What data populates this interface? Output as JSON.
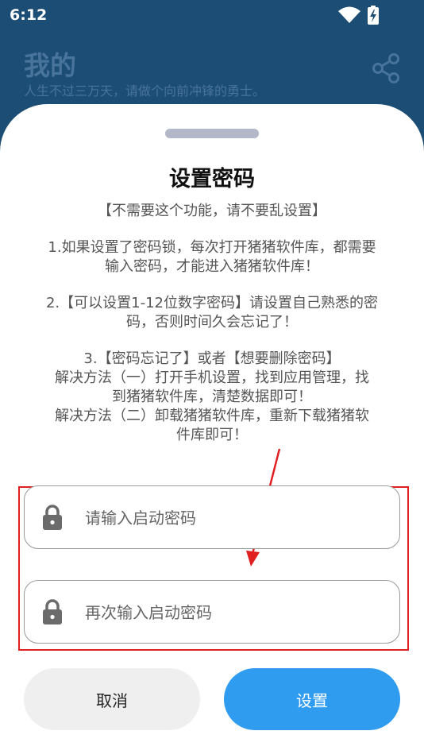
{
  "status_bar": {
    "time": "6:12"
  },
  "header": {
    "title": "我的",
    "subtitle": "人生不过三万天，请做个向前冲锋的勇士。"
  },
  "dialog": {
    "title": "设置密码",
    "notice_lines": [
      "【不需要这个功能，请不要乱设置】",
      "",
      "1.如果设置了密码锁，每次打开猪猪软件库，都需要",
      "输入密码，才能进入猪猪软件库！",
      "",
      "2.【可以设置1-12位数字密码】请设置自己熟悉的密",
      "码，否则时间久会忘记了！",
      "",
      "3.【密码忘记了】或者【想要删除密码】",
      "解决方法（一）打开手机设置，找到应用管理，找",
      "到猪猪软件库，清楚数据即可！",
      "解决方法（二）卸载猪猪软件库，重新下载猪猪软",
      "件库即可！"
    ],
    "password_placeholder": "请输入启动密码",
    "confirm_placeholder": "再次输入启动密码",
    "cancel_label": "取消",
    "confirm_label": "设置"
  },
  "colors": {
    "header_bg": "#1b4d75",
    "accent": "#2f9cf0",
    "highlight": "#e02020"
  },
  "icons": [
    "wifi-icon",
    "battery-icon",
    "share-icon",
    "lock-icon"
  ]
}
